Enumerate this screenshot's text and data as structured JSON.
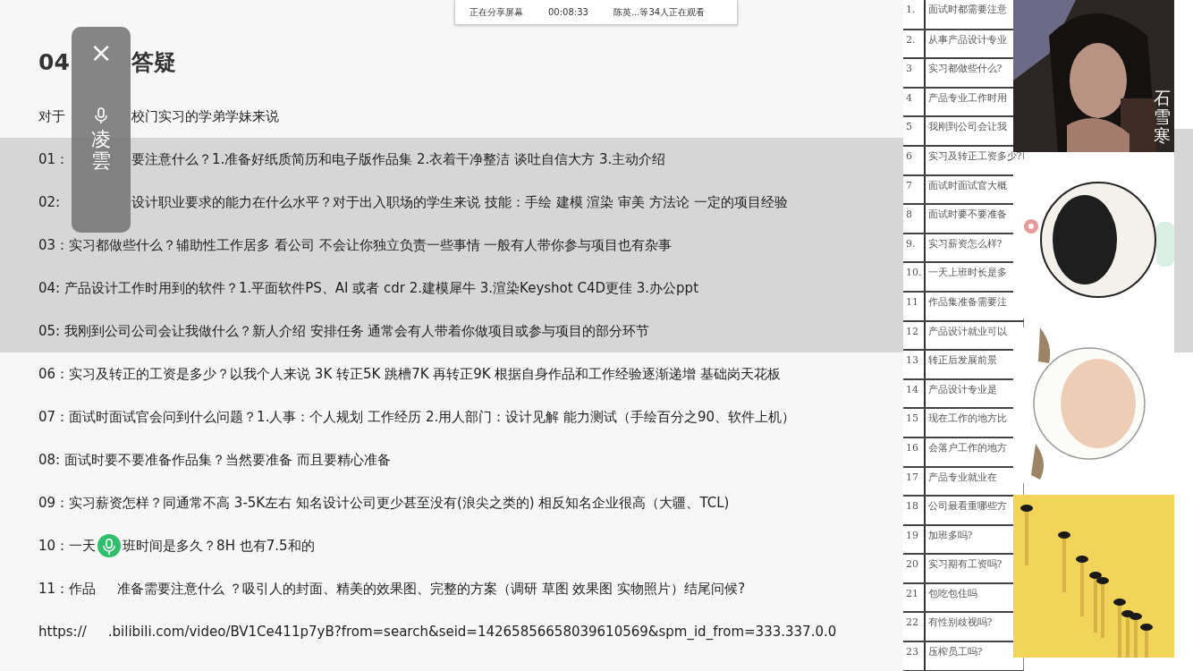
{
  "share_bar": {
    "status": "正在分享屏幕",
    "timer": "00:08:33",
    "viewers": "陈英...等34人正在观看"
  },
  "floating_panel": {
    "close": "×",
    "name": "凌雲"
  },
  "document": {
    "title": {
      "before": "04",
      "after": "答疑",
      "kind": "panel"
    },
    "intro": {
      "before": "对于",
      "after": "校门实习的学弟学妹来说",
      "kind": "panel"
    },
    "items": [
      {
        "before": "01：",
        "after": "要注意什么？1.准备好纸质简历和电子版作品集 2.衣着干净整洁 谈吐自信大方 3.主动介绍",
        "kind": "panel",
        "shaded": true
      },
      {
        "before": "02:",
        "after": "设计职业要求的能力在什么水平？对于出入职场的学生来说 技能：手绘 建模 渲染  审美 方法论 一定的项目经验",
        "kind": "panel",
        "shaded": true
      },
      {
        "before": "03：实习都做些什么？辅助性工作居多 看公司 不会让你独立负责一些事情 一般有人带你参与项目也有杂事",
        "shaded": true
      },
      {
        "before": "04:  产品设计工作时用到的软件？1.平面软件PS、AI 或者 cdr   2.建模犀牛  3.渲染Keyshot  C4D更佳 3.办公ppt",
        "shaded": true
      },
      {
        "before": "05:  我刚到公司公司会让我做什么？新人介绍 安排任务 通常会有人带着你做项目或参与项目的部分环节",
        "shaded": true
      },
      {
        "before": "06：实习及转正的工资是多少？以我个人来说 3K  转正5K  跳槽7K 再转正9K 根据自身作品和工作经验逐渐递增 基础岗天花板",
        "shaded": false
      },
      {
        "before": "07：面试时面试官会问到什么问题？1.人事：个人规划 工作经历  2.用人部门：设计见解 能力测试（手绘百分之90、软件上机）",
        "shaded": false
      },
      {
        "before": "08: 面试时要不要准备作品集？当然要准备 而且要精心准备",
        "shaded": false
      },
      {
        "before": "09：实习薪资怎样？同通常不高 3-5K左右 知名设计公司更少甚至没有(浪尖之类的)    相反知名企业很高（大疆、TCL)",
        "shaded": false
      },
      {
        "before": "10：一天",
        "after": "班时间是多久？8H 也有7.5和的",
        "kind": "mic",
        "shaded": false
      },
      {
        "before": "11：作品",
        "after": "准备需要注意什么 ？吸引人的封面、精美的效果图、完整的方案（调研 草图 效果图 实物照片）结尾问候?",
        "kind": "caption",
        "shaded": false
      }
    ],
    "link": {
      "before": "https://",
      "after": ".bilibili.com/video/BV1Ce411p7yB?from=search&seid=14265856658039610569&spm_id_from=333.337.0.0",
      "kind": "caption"
    }
  },
  "question_table": {
    "rows": [
      {
        "number": "1.",
        "text": "面试时都需要注意"
      },
      {
        "number": "2.",
        "text": "从事产品设计专业"
      },
      {
        "number": "3",
        "text": "实习都做些什么?"
      },
      {
        "number": "4",
        "text": "产品专业工作时用"
      },
      {
        "number": "5",
        "text": "我刚到公司会让我"
      },
      {
        "number": "6",
        "text": "实习及转正工资多少?"
      },
      {
        "number": "7",
        "text": "面试时面试官大概"
      },
      {
        "number": "8",
        "text": "面试时要不要准备"
      },
      {
        "number": "9.",
        "text": "实习薪资怎么样?"
      },
      {
        "number": "10.",
        "text": "一天上班时长是多"
      },
      {
        "number": "11",
        "text": "作品集准备需要注"
      },
      {
        "number": "12",
        "text": "产品设计就业可以"
      },
      {
        "number": "13",
        "text": "转正后发展前景"
      },
      {
        "number": "14",
        "text": "产品设计专业是"
      },
      {
        "number": "15",
        "text": "现在工作的地方比"
      },
      {
        "number": "16",
        "text": "会落户工作的地方"
      },
      {
        "number": "17",
        "text": "产品专业就业在"
      },
      {
        "number": "18",
        "text": "公司最看重哪些方"
      },
      {
        "number": "19",
        "text": "加班多吗?"
      },
      {
        "number": "20",
        "text": "实习期有工资吗?"
      },
      {
        "number": "21",
        "text": "包吃包住吗"
      },
      {
        "number": "22",
        "text": "有性别歧视吗?"
      },
      {
        "number": "23",
        "text": "压榨员工吗?"
      }
    ]
  },
  "video_tiles": [
    {
      "kind": "picture",
      "name": "石雪寒"
    },
    {
      "kind": "picture"
    },
    {
      "kind": "picture"
    },
    {
      "kind": "picture"
    }
  ]
}
